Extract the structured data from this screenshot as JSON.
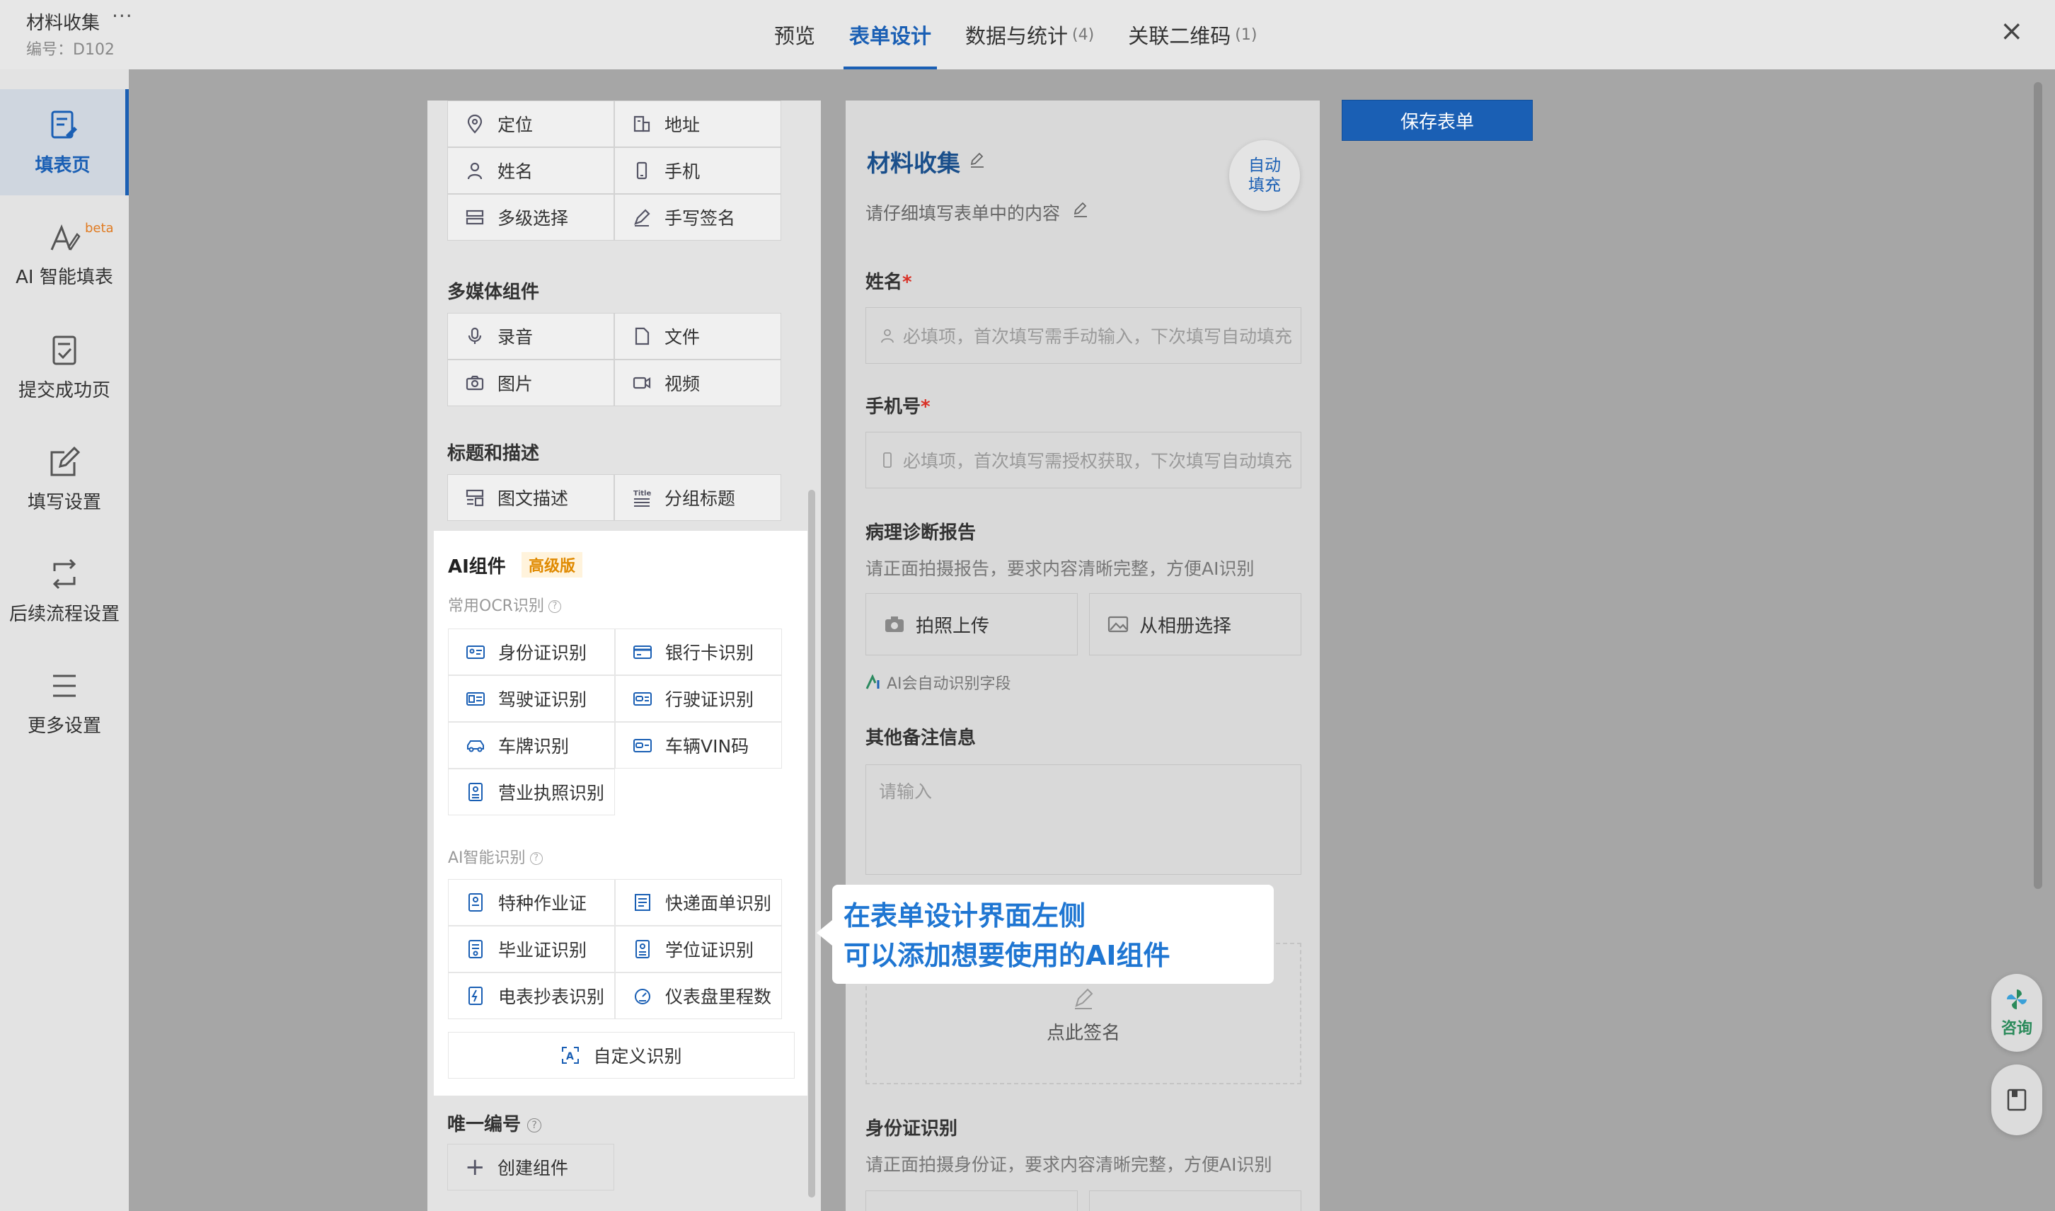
{
  "header": {
    "title": "材料收集",
    "menu": "···",
    "code": "编号：D102",
    "tabs": [
      {
        "label": "预览",
        "count": ""
      },
      {
        "label": "表单设计",
        "count": ""
      },
      {
        "label": "数据与统计",
        "count": "(4)"
      },
      {
        "label": "关联二维码",
        "count": "(1)"
      }
    ],
    "close": "×"
  },
  "leftnav": [
    {
      "label": "填表页",
      "icon": "form-page-icon"
    },
    {
      "label": "AI 智能填表",
      "icon": "ai-fill-icon",
      "badge": "beta"
    },
    {
      "label": "提交成功页",
      "icon": "submit-success-icon"
    },
    {
      "label": "填写设置",
      "icon": "edit-settings-icon"
    },
    {
      "label": "后续流程设置",
      "icon": "flow-icon"
    },
    {
      "label": "更多设置",
      "icon": "menu-icon"
    }
  ],
  "panel": {
    "top_items": [
      "定位",
      "地址",
      "姓名",
      "手机",
      "多级选择",
      "手写签名"
    ],
    "media_title": "多媒体组件",
    "media_items": [
      "录音",
      "文件",
      "图片",
      "视频"
    ],
    "title_section": "标题和描述",
    "title_items": [
      "图文描述",
      "分组标题"
    ],
    "ai": {
      "title": "AI组件",
      "badge": "高级版",
      "ocr_title": "常用OCR识别",
      "ocr_items": [
        "身份证识别",
        "银行卡识别",
        "驾驶证识别",
        "行驶证识别",
        "车牌识别",
        "车辆VIN码",
        "营业执照识别"
      ],
      "smart_title": "AI智能识别",
      "smart_items": [
        "特种作业证",
        "快递面单识别",
        "毕业证识别",
        "学位证识别",
        "电表抄表识别",
        "仪表盘里程数"
      ],
      "custom": "自定义识别"
    },
    "unique_title": "唯一编号",
    "create": "创建组件"
  },
  "form": {
    "title": "材料收集",
    "desc": "请仔细填写表单中的内容",
    "autofill": "自动填充",
    "name_label": "姓名",
    "name_placeholder": "必填项，首次填写需手动输入，下次填写自动填充",
    "phone_label": "手机号",
    "phone_placeholder": "必填项，首次填写需授权获取，下次填写自动填充",
    "report_label": "病理诊断报告",
    "report_help": "请正面拍摄报告，要求内容清晰完整，方便AI识别",
    "photo_btn": "拍照上传",
    "album_btn": "从相册选择",
    "ai_hint": "AI会自动识别字段",
    "notes_label": "其他备注信息",
    "notes_placeholder": "请输入",
    "sign": "点此签名",
    "id_label": "身份证识别",
    "id_help": "请正面拍摄身份证，要求内容清晰完整，方便AI识别"
  },
  "save_button": "保存表单",
  "tip": {
    "line1": "在表单设计界面左侧",
    "line2": "可以添加想要使用的AI组件"
  },
  "float": {
    "consult": "咨询"
  },
  "colors": {
    "accent": "#1a5fb4",
    "badge": "#e08a00",
    "tip_text": "#1f76d2"
  }
}
